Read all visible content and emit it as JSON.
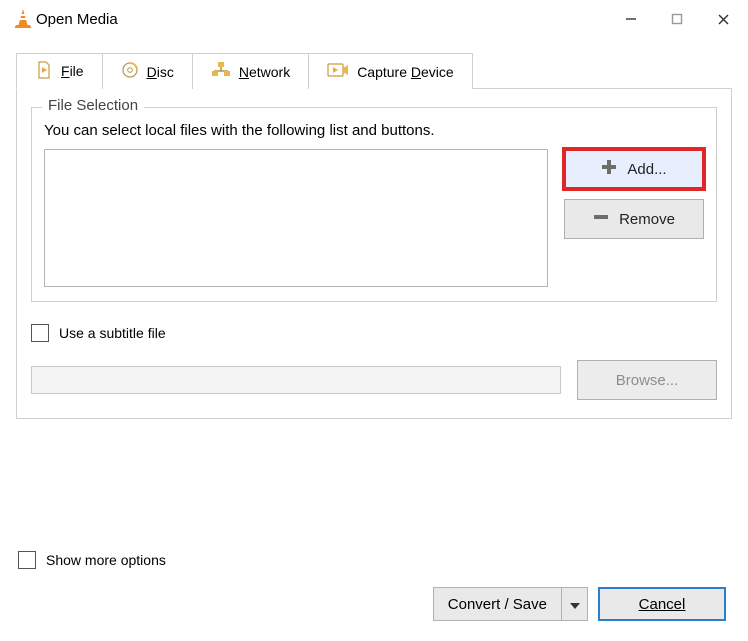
{
  "window": {
    "title": "Open Media"
  },
  "tabs": {
    "file": {
      "prefix": "",
      "mnemonic": "F",
      "rest": "ile"
    },
    "disc": {
      "prefix": "",
      "mnemonic": "D",
      "rest": "isc"
    },
    "network": {
      "prefix": "",
      "mnemonic": "N",
      "rest": "etwork"
    },
    "capture": {
      "prefix": "Capture ",
      "mnemonic": "D",
      "rest": "evice"
    }
  },
  "file_selection": {
    "legend": "File Selection",
    "help": "You can select local files with the following list and buttons.",
    "add": "Add...",
    "remove": "Remove"
  },
  "subtitle": {
    "use_label": "Use a subtitle file",
    "browse": "Browse..."
  },
  "more_options": {
    "prefix": "Show ",
    "mnemonic": "m",
    "rest": "ore options"
  },
  "footer": {
    "convert_save": "Convert / Save",
    "cancel_mnemonic": "C",
    "cancel_rest": "ancel"
  }
}
